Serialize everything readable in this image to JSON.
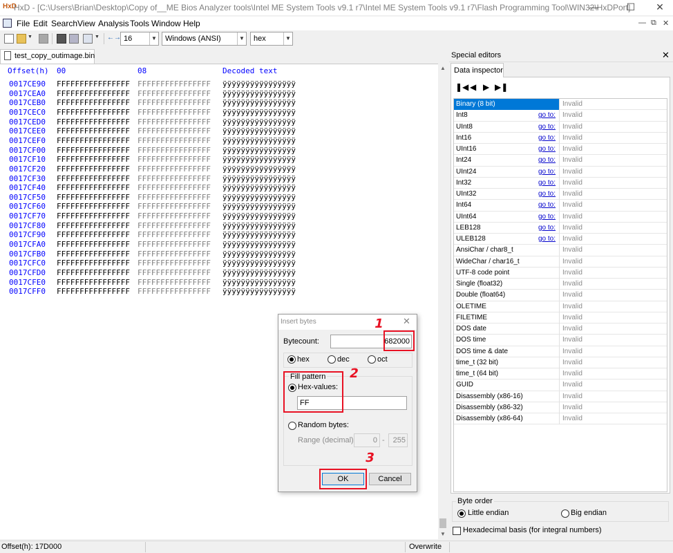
{
  "window": {
    "app_logo": "HxD",
    "title": "HxD - [C:\\Users\\Brian\\Desktop\\Copy of__ME Bios Analyzer tools\\Intel ME System Tools v9.1 r7\\Intel ME System Tools v9.1 r7\\Flash Programming Tool\\WIN32\\HxDPort]"
  },
  "menu": [
    "File",
    "Edit",
    "Search",
    "View",
    "Analysis",
    "Tools",
    "Window",
    "Help"
  ],
  "toolbar": {
    "bytes_per_row": "16",
    "charset": "Windows (ANSI)",
    "offset_base": "hex"
  },
  "file_tab": "test_copy_outimage.bin",
  "hex": {
    "header_offset": "Offset(h)",
    "header_col1": "00",
    "header_col2": "08",
    "header_decoded": "Decoded text",
    "rows": [
      {
        "offset": "0017CE90",
        "h1": "FFFFFFFFFFFFFFFF",
        "h2": "FFFFFFFFFFFFFFFF",
        "text": "ÿÿÿÿÿÿÿÿÿÿÿÿÿÿÿÿ"
      },
      {
        "offset": "0017CEA0",
        "h1": "FFFFFFFFFFFFFFFF",
        "h2": "FFFFFFFFFFFFFFFF",
        "text": "ÿÿÿÿÿÿÿÿÿÿÿÿÿÿÿÿ"
      },
      {
        "offset": "0017CEB0",
        "h1": "FFFFFFFFFFFFFFFF",
        "h2": "FFFFFFFFFFFFFFFF",
        "text": "ÿÿÿÿÿÿÿÿÿÿÿÿÿÿÿÿ"
      },
      {
        "offset": "0017CEC0",
        "h1": "FFFFFFFFFFFFFFFF",
        "h2": "FFFFFFFFFFFFFFFF",
        "text": "ÿÿÿÿÿÿÿÿÿÿÿÿÿÿÿÿ"
      },
      {
        "offset": "0017CED0",
        "h1": "FFFFFFFFFFFFFFFF",
        "h2": "FFFFFFFFFFFFFFFF",
        "text": "ÿÿÿÿÿÿÿÿÿÿÿÿÿÿÿÿ"
      },
      {
        "offset": "0017CEE0",
        "h1": "FFFFFFFFFFFFFFFF",
        "h2": "FFFFFFFFFFFFFFFF",
        "text": "ÿÿÿÿÿÿÿÿÿÿÿÿÿÿÿÿ"
      },
      {
        "offset": "0017CEF0",
        "h1": "FFFFFFFFFFFFFFFF",
        "h2": "FFFFFFFFFFFFFFFF",
        "text": "ÿÿÿÿÿÿÿÿÿÿÿÿÿÿÿÿ"
      },
      {
        "offset": "0017CF00",
        "h1": "FFFFFFFFFFFFFFFF",
        "h2": "FFFFFFFFFFFFFFFF",
        "text": "ÿÿÿÿÿÿÿÿÿÿÿÿÿÿÿÿ"
      },
      {
        "offset": "0017CF10",
        "h1": "FFFFFFFFFFFFFFFF",
        "h2": "FFFFFFFFFFFFFFFF",
        "text": "ÿÿÿÿÿÿÿÿÿÿÿÿÿÿÿÿ"
      },
      {
        "offset": "0017CF20",
        "h1": "FFFFFFFFFFFFFFFF",
        "h2": "FFFFFFFFFFFFFFFF",
        "text": "ÿÿÿÿÿÿÿÿÿÿÿÿÿÿÿÿ"
      },
      {
        "offset": "0017CF30",
        "h1": "FFFFFFFFFFFFFFFF",
        "h2": "FFFFFFFFFFFFFFFF",
        "text": "ÿÿÿÿÿÿÿÿÿÿÿÿÿÿÿÿ"
      },
      {
        "offset": "0017CF40",
        "h1": "FFFFFFFFFFFFFFFF",
        "h2": "FFFFFFFFFFFFFFFF",
        "text": "ÿÿÿÿÿÿÿÿÿÿÿÿÿÿÿÿ"
      },
      {
        "offset": "0017CF50",
        "h1": "FFFFFFFFFFFFFFFF",
        "h2": "FFFFFFFFFFFFFFFF",
        "text": "ÿÿÿÿÿÿÿÿÿÿÿÿÿÿÿÿ"
      },
      {
        "offset": "0017CF60",
        "h1": "FFFFFFFFFFFFFFFF",
        "h2": "FFFFFFFFFFFFFFFF",
        "text": "ÿÿÿÿÿÿÿÿÿÿÿÿÿÿÿÿ"
      },
      {
        "offset": "0017CF70",
        "h1": "FFFFFFFFFFFFFFFF",
        "h2": "FFFFFFFFFFFFFFFF",
        "text": "ÿÿÿÿÿÿÿÿÿÿÿÿÿÿÿÿ"
      },
      {
        "offset": "0017CF80",
        "h1": "FFFFFFFFFFFFFFFF",
        "h2": "FFFFFFFFFFFFFFFF",
        "text": "ÿÿÿÿÿÿÿÿÿÿÿÿÿÿÿÿ"
      },
      {
        "offset": "0017CF90",
        "h1": "FFFFFFFFFFFFFFFF",
        "h2": "FFFFFFFFFFFFFFFF",
        "text": "ÿÿÿÿÿÿÿÿÿÿÿÿÿÿÿÿ"
      },
      {
        "offset": "0017CFA0",
        "h1": "FFFFFFFFFFFFFFFF",
        "h2": "FFFFFFFFFFFFFFFF",
        "text": "ÿÿÿÿÿÿÿÿÿÿÿÿÿÿÿÿ"
      },
      {
        "offset": "0017CFB0",
        "h1": "FFFFFFFFFFFFFFFF",
        "h2": "FFFFFFFFFFFFFFFF",
        "text": "ÿÿÿÿÿÿÿÿÿÿÿÿÿÿÿÿ"
      },
      {
        "offset": "0017CFC0",
        "h1": "FFFFFFFFFFFFFFFF",
        "h2": "FFFFFFFFFFFFFFFF",
        "text": "ÿÿÿÿÿÿÿÿÿÿÿÿÿÿÿÿ"
      },
      {
        "offset": "0017CFD0",
        "h1": "FFFFFFFFFFFFFFFF",
        "h2": "FFFFFFFFFFFFFFFF",
        "text": "ÿÿÿÿÿÿÿÿÿÿÿÿÿÿÿÿ"
      },
      {
        "offset": "0017CFE0",
        "h1": "FFFFFFFFFFFFFFFF",
        "h2": "FFFFFFFFFFFFFFFF",
        "text": "ÿÿÿÿÿÿÿÿÿÿÿÿÿÿÿÿ"
      },
      {
        "offset": "0017CFF0",
        "h1": "FFFFFFFFFFFFFFFF",
        "h2": "FFFFFFFFFFFFFFFF",
        "text": "ÿÿÿÿÿÿÿÿÿÿÿÿÿÿÿÿ"
      }
    ]
  },
  "special_editors": {
    "title": "Special editors",
    "tab": "Data inspector",
    "rows": [
      {
        "name": "Binary (8 bit)",
        "goto": "",
        "value": "Invalid",
        "selected": true
      },
      {
        "name": "Int8",
        "goto": "go to:",
        "value": "Invalid"
      },
      {
        "name": "UInt8",
        "goto": "go to:",
        "value": "Invalid"
      },
      {
        "name": "Int16",
        "goto": "go to:",
        "value": "Invalid"
      },
      {
        "name": "UInt16",
        "goto": "go to:",
        "value": "Invalid"
      },
      {
        "name": "Int24",
        "goto": "go to:",
        "value": "Invalid"
      },
      {
        "name": "UInt24",
        "goto": "go to:",
        "value": "Invalid"
      },
      {
        "name": "Int32",
        "goto": "go to:",
        "value": "Invalid"
      },
      {
        "name": "UInt32",
        "goto": "go to:",
        "value": "Invalid"
      },
      {
        "name": "Int64",
        "goto": "go to:",
        "value": "Invalid"
      },
      {
        "name": "UInt64",
        "goto": "go to:",
        "value": "Invalid"
      },
      {
        "name": "LEB128",
        "goto": "go to:",
        "value": "Invalid"
      },
      {
        "name": "ULEB128",
        "goto": "go to:",
        "value": "Invalid"
      },
      {
        "name": "AnsiChar / char8_t",
        "goto": "",
        "value": "Invalid"
      },
      {
        "name": "WideChar / char16_t",
        "goto": "",
        "value": "Invalid"
      },
      {
        "name": "UTF-8 code point",
        "goto": "",
        "value": "Invalid"
      },
      {
        "name": "Single (float32)",
        "goto": "",
        "value": "Invalid"
      },
      {
        "name": "Double (float64)",
        "goto": "",
        "value": "Invalid"
      },
      {
        "name": "OLETIME",
        "goto": "",
        "value": "Invalid"
      },
      {
        "name": "FILETIME",
        "goto": "",
        "value": "Invalid"
      },
      {
        "name": "DOS date",
        "goto": "",
        "value": "Invalid"
      },
      {
        "name": "DOS time",
        "goto": "",
        "value": "Invalid"
      },
      {
        "name": "DOS time & date",
        "goto": "",
        "value": "Invalid"
      },
      {
        "name": "time_t (32 bit)",
        "goto": "",
        "value": "Invalid"
      },
      {
        "name": "time_t (64 bit)",
        "goto": "",
        "value": "Invalid"
      },
      {
        "name": "GUID",
        "goto": "",
        "value": "Invalid"
      },
      {
        "name": "Disassembly (x86-16)",
        "goto": "",
        "value": "Invalid"
      },
      {
        "name": "Disassembly (x86-32)",
        "goto": "",
        "value": "Invalid"
      },
      {
        "name": "Disassembly (x86-64)",
        "goto": "",
        "value": "Invalid"
      }
    ],
    "byte_order_label": "Byte order",
    "little_endian": "Little endian",
    "big_endian": "Big endian",
    "hex_basis": "Hexadecimal basis (for integral numbers)"
  },
  "status": {
    "offset": "Offset(h): 17D000",
    "mode": "Overwrite"
  },
  "dialog": {
    "title": "Insert bytes",
    "bytecount_label": "Bytecount:",
    "bytecount_value": "682000",
    "radio_hex": "hex",
    "radio_dec": "dec",
    "radio_oct": "oct",
    "fill_pattern_label": "Fill pattern",
    "hex_values_label": "Hex-values:",
    "hex_values_value": "FF",
    "random_bytes_label": "Random bytes:",
    "range_label": "Range (decimal):",
    "range_from": "0",
    "range_to": "255",
    "ok": "OK",
    "cancel": "Cancel"
  },
  "annotations": {
    "a1": "1",
    "a2": "2",
    "a3": "3"
  }
}
